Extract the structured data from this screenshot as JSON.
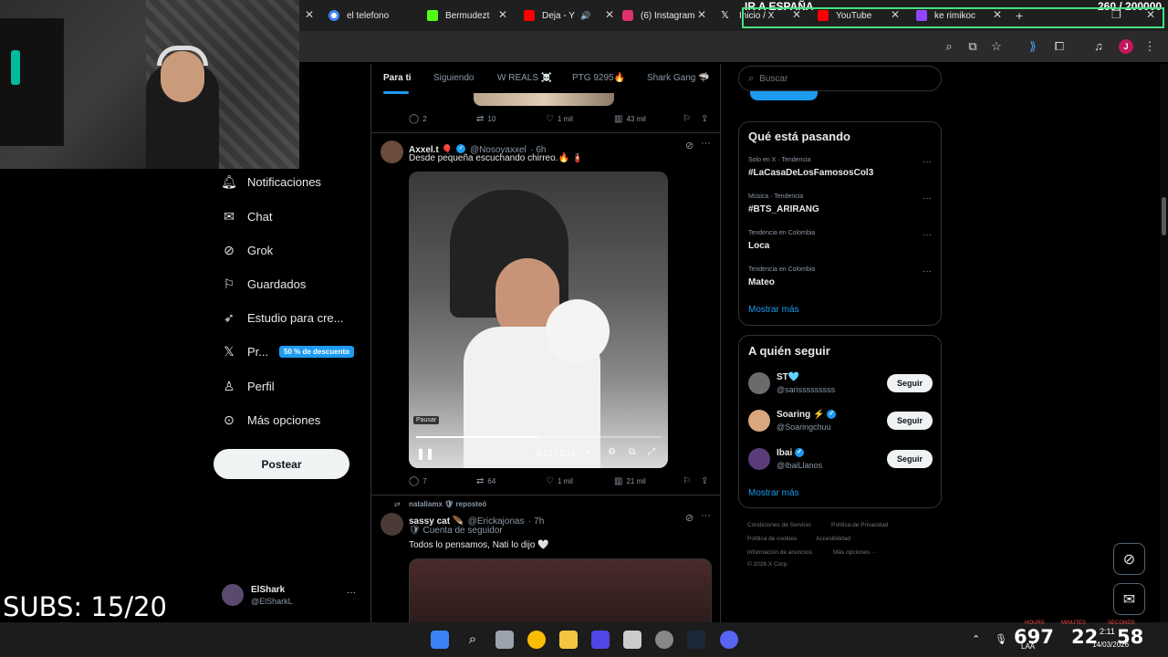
{
  "stream": {
    "title": "IR A ESPAÑA",
    "counter": "260   / 200000",
    "subs": "SUBS: 15/20"
  },
  "browser": {
    "tabs": [
      {
        "label": "el telefono",
        "color": "#4285f4"
      },
      {
        "label": "Bermudezt",
        "color": "#53fc18"
      },
      {
        "label": "Deja - Y",
        "color": "#ff0000"
      },
      {
        "label": "(6) Instagram",
        "color": "#e1306c"
      },
      {
        "label": "Inicio / X",
        "color": "#ffffff"
      },
      {
        "label": "YouTube",
        "color": "#ff0000"
      },
      {
        "label": "ke rimikoc",
        "color": "#9146ff"
      }
    ],
    "profile_initial": "J"
  },
  "nav": {
    "items": [
      {
        "label": "Notificaciones",
        "icon": "bell-icon"
      },
      {
        "label": "Chat",
        "icon": "mail-icon"
      },
      {
        "label": "Grok",
        "icon": "grok-icon"
      },
      {
        "label": "Guardados",
        "icon": "bookmark-icon"
      },
      {
        "label": "Estudio para cre...",
        "icon": "rocket-icon"
      },
      {
        "label": "Pr...",
        "icon": "x-logo-icon"
      },
      {
        "label": "Perfil",
        "icon": "person-icon"
      },
      {
        "label": "Más opciones",
        "icon": "more-circle-icon"
      }
    ],
    "premium_badge": "50 % de descuento",
    "post_button": "Postear",
    "account": {
      "name": "ElShark",
      "handle": "@ElSharkL",
      "more": "···"
    }
  },
  "timeline": {
    "tabs": [
      "Para ti",
      "Siguiendo",
      "W REALS ☠️",
      "PTG 9295🔥",
      "Shark Gang 🦈"
    ],
    "prev_actions": {
      "replies": "2",
      "reposts": "10",
      "likes": "1 mil",
      "views": "43 mil"
    },
    "tweet1": {
      "name": "Axxel.t 🎈",
      "handle": "@Nosoyaxxel",
      "time": "· 6h",
      "text": "Desde pequeña escuchando chirreo.🔥 🧯",
      "video_tooltip": "Pausar",
      "video_time": "0:17 / 0:34",
      "video_progress": 0.5,
      "actions": {
        "replies": "7",
        "reposts": "64",
        "likes": "1 mil",
        "views": "21 mil"
      }
    },
    "tweet2": {
      "repost_note": "nataliamx 🛡 reposteó",
      "name": "sassy cat 🪶",
      "handle": "@Erickajonas",
      "time": "· 7h",
      "badge_line": "🛡 Cuenta de seguidor",
      "text": "Todos lo pensamos, Nati lo dijo 🤍"
    }
  },
  "sidebar": {
    "search_placeholder": "Buscar",
    "trends_title": "Qué está pasando",
    "trends": [
      {
        "meta": "Solo en X · Tendencia",
        "name": "#LaCasaDeLosFamososCol3"
      },
      {
        "meta": "Música · Tendencia",
        "name": "#BTS_ARIRANG"
      },
      {
        "meta": "Tendencia en Colombia",
        "name": "Loca"
      },
      {
        "meta": "Tendencia en Colombia",
        "name": "Mateo"
      }
    ],
    "trends_more": "Mostrar más",
    "follow_title": "A quién seguir",
    "follow": [
      {
        "name": "ST🩵",
        "handle": "@sarisssssssss",
        "button": "Seguir"
      },
      {
        "name": "Soaring ⚡",
        "handle": "@Soaringchuu",
        "button": "Seguir"
      },
      {
        "name": "Ibai",
        "handle": "@IbaiLlanos",
        "button": "Seguir"
      }
    ],
    "follow_more": "Mostrar más",
    "footer": [
      "Condiciones de Servicio",
      "Política de Privacidad",
      "Política de cookies",
      "Accesibilidad",
      "Información de anuncios",
      "Más opciones ···",
      "© 2026 X Corp."
    ]
  },
  "taskbar": {
    "num1": "697",
    "num2": "22",
    "num3": "58",
    "labels": [
      "HOURS",
      "MINUTES",
      "SECONDS"
    ],
    "time": "2:11",
    "date": "14/03/2026",
    "lang": "LAA"
  }
}
